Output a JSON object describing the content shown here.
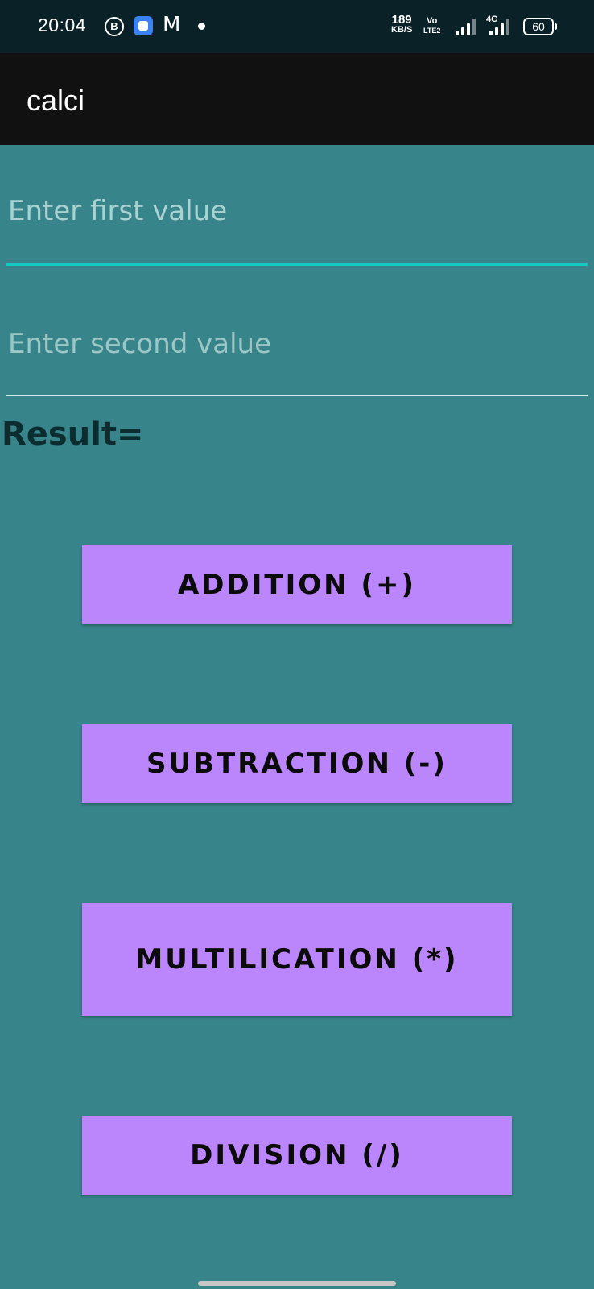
{
  "status_bar": {
    "time": "20:04",
    "notif_b": "B",
    "gmail_glyph": "M",
    "speed_value": "189",
    "speed_unit": "KB/S",
    "volte_top": "Vo",
    "volte_bottom": "LTE2",
    "network": "4G",
    "battery": "60"
  },
  "app_bar": {
    "title": "calci"
  },
  "form": {
    "first_placeholder": "Enter first value",
    "second_placeholder": "Enter second value",
    "result_label": "Result="
  },
  "buttons": {
    "add": "ADDITION  (+)",
    "sub": "SUBTRACTION  (-)",
    "mul": "MULTILICATION (*)",
    "div": "DIVISION  (/)"
  },
  "colors": {
    "background": "#37848a",
    "app_bar": "#111111",
    "status_bar": "#0a2227",
    "button": "#bb86fc",
    "focus_line": "#12cbc0"
  }
}
